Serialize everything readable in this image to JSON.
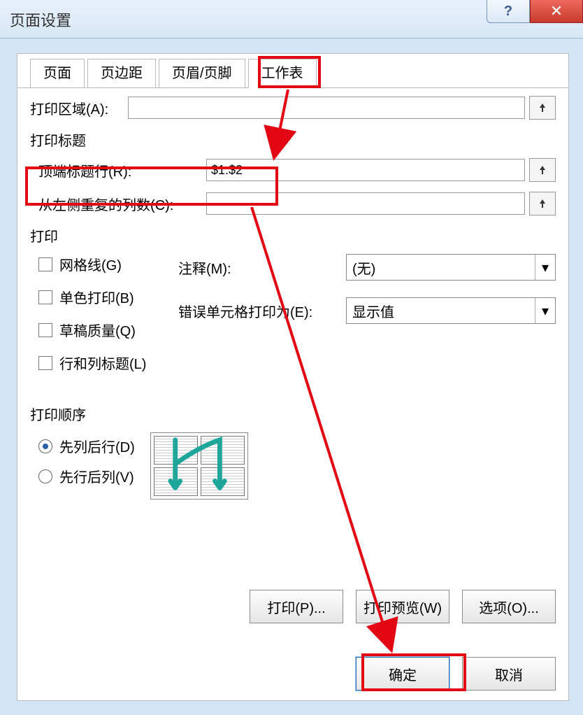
{
  "titlebar": {
    "title": "页面设置"
  },
  "tabs": [
    {
      "label": "页面"
    },
    {
      "label": "页边距"
    },
    {
      "label": "页眉/页脚"
    },
    {
      "label": "工作表"
    }
  ],
  "print_area": {
    "label": "打印区域(A):",
    "value": ""
  },
  "print_titles_header": "打印标题",
  "top_title_row": {
    "label": "顶端标题行(R):",
    "value": "$1:$2"
  },
  "left_repeat_col": {
    "label": "从左侧重复的列数(C):",
    "value": ""
  },
  "print_header": "打印",
  "checks": {
    "gridlines": "网格线(G)",
    "bw": "单色打印(B)",
    "draft": "草稿质量(Q)",
    "rowcol": "行和列标题(L)"
  },
  "comments": {
    "label": "注释(M):",
    "value": "(无)"
  },
  "errors": {
    "label": "错误单元格打印为(E):",
    "value": "显示值"
  },
  "order_header": "打印顺序",
  "order": {
    "downover": "先列后行(D)",
    "overdown": "先行后列(V)"
  },
  "buttons": {
    "print": "打印(P)...",
    "preview": "打印预览(W)",
    "options": "选项(O)...",
    "ok": "确定",
    "cancel": "取消"
  }
}
